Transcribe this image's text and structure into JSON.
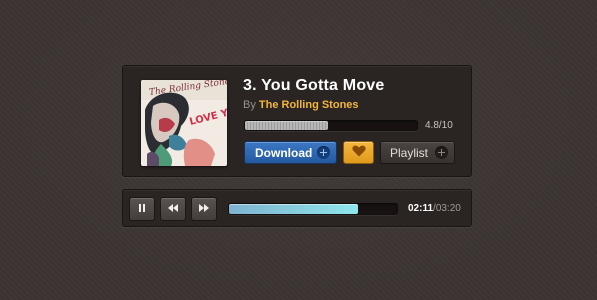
{
  "track": {
    "title": "3. You Gotta Move",
    "by_label": "By",
    "artist": "The Rolling Stones",
    "rating_text": "4.8/10",
    "rating_fraction": 0.48,
    "album_art": {
      "caption_top": "The Rolling Stones",
      "caption_side": "LOVE YOU LIVE"
    }
  },
  "actions": {
    "download_label": "Download",
    "playlist_label": "Playlist",
    "heart_icon": "heart-icon",
    "plus_icon": "plus-icon"
  },
  "player": {
    "pause_icon": "pause-icon",
    "rewind_icon": "rewind-icon",
    "forward_icon": "fast-forward-icon",
    "progress_fraction": 0.77,
    "current_time": "02:11",
    "separator": "/",
    "total_time": "03:20"
  },
  "colors": {
    "accent_blue": "#2f6bb5",
    "accent_orange": "#f2a929",
    "artist_color": "#f2b63a",
    "progress_color": "#8fe6ec"
  }
}
